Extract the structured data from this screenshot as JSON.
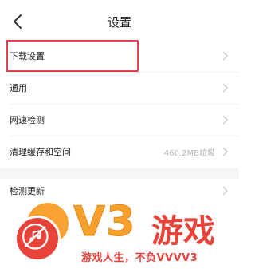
{
  "header": {
    "title": "设置",
    "back_icon": "chevron-left-icon"
  },
  "settings": {
    "items": [
      {
        "label": "下载设置",
        "value": ""
      },
      {
        "label": "通用",
        "value": ""
      },
      {
        "label": "网速检测",
        "value": ""
      },
      {
        "label": "清理缓存和空间",
        "value": "460.2MB垃圾"
      },
      {
        "label": "检测更新",
        "value": ""
      }
    ]
  },
  "watermark": {
    "logo_text": "V3",
    "brand": "游戏",
    "slogan": "游戏人生，不负VVVV3",
    "colors": {
      "orange": "#f6a12f",
      "red": "#e8433a"
    }
  },
  "highlight_color": "#e8404f"
}
